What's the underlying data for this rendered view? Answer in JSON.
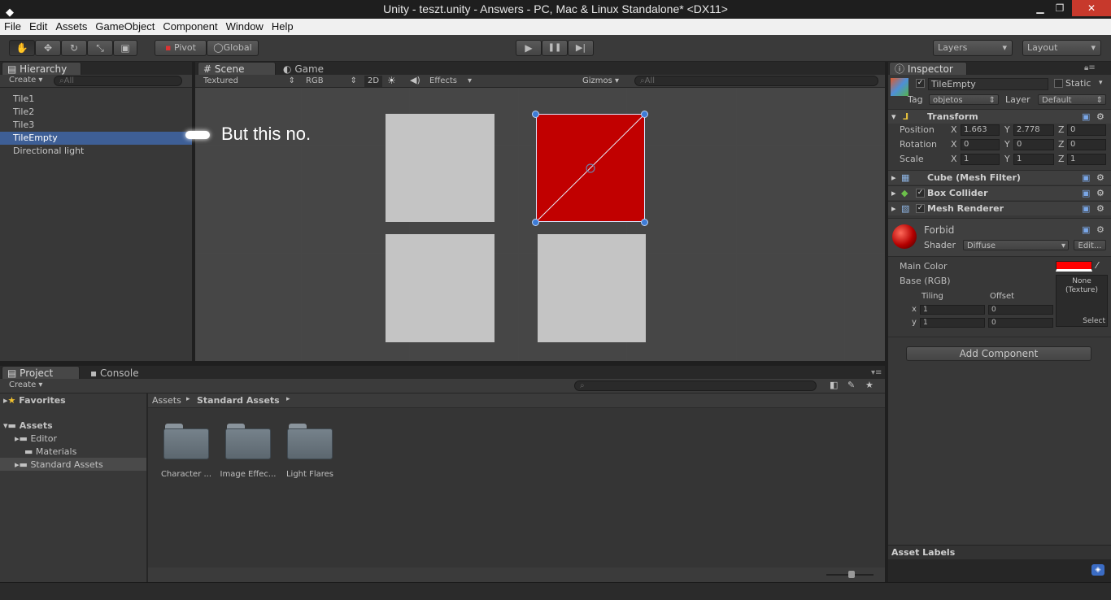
{
  "window": {
    "title": "Unity - teszt.unity - Answers - PC, Mac & Linux Standalone* <DX11>",
    "minimize": "▁",
    "restore": "❐",
    "close": "✕",
    "app_icon": "unity-icon"
  },
  "menu": [
    "File",
    "Edit",
    "Assets",
    "GameObject",
    "Component",
    "Window",
    "Help"
  ],
  "toolbar": {
    "tools": [
      "✋",
      "✥",
      "↻",
      "⤡",
      "▣"
    ],
    "pivot": "Pivot",
    "global": "Global",
    "play": "▶",
    "pause": "❚❚",
    "step": "▶|",
    "layers": "Layers",
    "layout": "Layout"
  },
  "hierarchy": {
    "tab": "Hierarchy",
    "create": "Create ▾",
    "search_placeholder": "All",
    "items": [
      "Tile1",
      "Tile2",
      "Tile3",
      "TileEmpty",
      "Directional light"
    ],
    "selected_index": 3,
    "annotation": "But this no."
  },
  "scene": {
    "tab_scene": "Scene",
    "tab_game": "Game",
    "textured": "Textured",
    "rgb": "RGB",
    "mode_2d": "2D",
    "effects": "Effects",
    "gizmos": "Gizmos ▾",
    "search_placeholder": "All",
    "selected_color": "#c10000",
    "tile_color": "#c4c4c4"
  },
  "project": {
    "tab_project": "Project",
    "tab_console": "Console",
    "create": "Create ▾",
    "favorites": "Favorites",
    "assets": "Assets",
    "tree": [
      "Editor",
      "Materials",
      "Standard Assets"
    ],
    "breadcrumb_root": "Assets",
    "breadcrumb_current": "Standard Assets",
    "folders": [
      "Character ...",
      "Image Effec...",
      "Light Flares"
    ]
  },
  "inspector": {
    "tab": "Inspector",
    "object_name": "TileEmpty",
    "static": "Static",
    "tag_label": "Tag",
    "tag": "objetos",
    "layer_label": "Layer",
    "layer": "Default",
    "transform": {
      "title": "Transform",
      "position": {
        "label": "Position",
        "x": "1.663",
        "y": "2.778",
        "z": "0"
      },
      "rotation": {
        "label": "Rotation",
        "x": "0",
        "y": "0",
        "z": "0"
      },
      "scale": {
        "label": "Scale",
        "x": "1",
        "y": "1",
        "z": "1"
      }
    },
    "components": [
      "Cube (Mesh Filter)",
      "Box Collider",
      "Mesh Renderer"
    ],
    "material": {
      "name": "Forbid",
      "shader_label": "Shader",
      "shader": "Diffuse",
      "edit": "Edit...",
      "main_color_label": "Main Color",
      "base_label": "Base (RGB)",
      "tiling": "Tiling",
      "offset": "Offset",
      "tx": "1",
      "ty": "1",
      "ox": "0",
      "oy": "0",
      "texture_none": "None\n(Texture)",
      "select": "Select",
      "main_color": "#ff0000"
    },
    "add_component": "Add Component",
    "asset_labels": "Asset Labels"
  }
}
